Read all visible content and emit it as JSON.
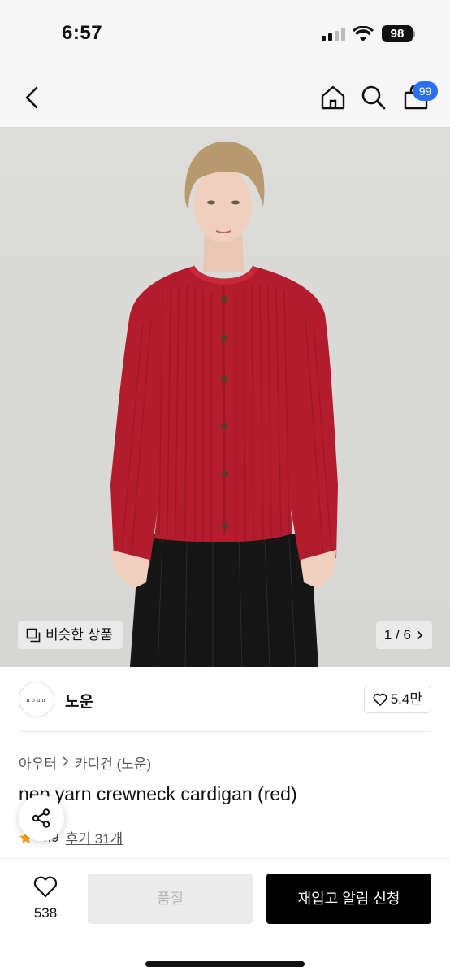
{
  "status_bar": {
    "time": "6:57",
    "battery": "98"
  },
  "nav": {
    "cart_count": "99"
  },
  "gallery": {
    "similar_label": "비슷한 상품",
    "page_indicator": "1 / 6"
  },
  "brand": {
    "logo_text": "noun",
    "name": "노운",
    "likes": "5.4만"
  },
  "breadcrumb": {
    "category": "아우터",
    "subcategory": "카디건 (노운)"
  },
  "product": {
    "title": "nep yarn crewneck cardigan (red)",
    "rating": "4.9",
    "reviews": "후기 31개"
  },
  "bottom": {
    "wish_count": "538",
    "soldout_label": "품절",
    "restock_label": "재입고 알림 신청"
  },
  "colors": {
    "accent": "#2b6ff2",
    "cardigan": "#b31c2c",
    "star": "#f5a623"
  }
}
